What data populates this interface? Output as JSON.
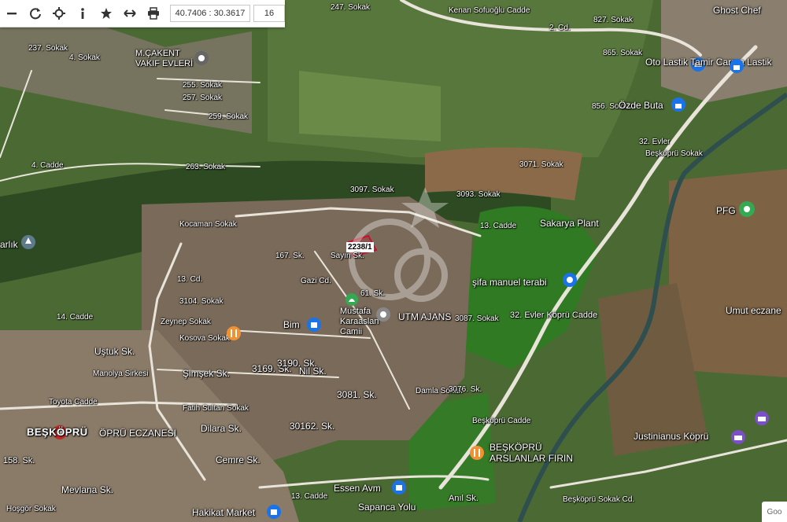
{
  "toolbar": {
    "buttons": [
      {
        "name": "zoom-out-button",
        "icon": "minus-icon"
      },
      {
        "name": "refresh-button",
        "icon": "refresh-icon"
      },
      {
        "name": "locate-button",
        "icon": "crosshair-icon"
      },
      {
        "name": "info-button",
        "icon": "info-icon"
      },
      {
        "name": "favorite-button",
        "icon": "star-icon"
      },
      {
        "name": "measure-button",
        "icon": "arrows-horizontal-icon"
      },
      {
        "name": "print-button",
        "icon": "printer-icon"
      }
    ],
    "coordinates": "40.7406 : 30.3617",
    "zoom_level": "16"
  },
  "parcel": {
    "label": "2238/1",
    "outline_color": "#c8102e"
  },
  "map": {
    "streets": [
      "247. Sokak",
      "Kenan Sofuoğlu Cadde",
      "2. Cd.",
      "827. Sokak",
      "237. Sokak",
      "4. Sokak",
      "255. Sokak",
      "257. Sokak",
      "259. Sokak",
      "4. Cadde",
      "263. Sokak",
      "865. Sokak",
      "856. Sokak",
      "32. Evler",
      "Beşköprü Sokak",
      "3071. Sokak",
      "3097. Sokak",
      "3093. Sokak",
      "13. Cadde",
      "167. Sk.",
      "Kocaman Sokak",
      "Sayın Sk.",
      "Gazi Cd.",
      "61. Sk.",
      "13. Cd.",
      "3104. Sokak",
      "14. Cadde",
      "Zeynep Sokak",
      "Kosova Sokak",
      "Uştuk Sk.",
      "Manolya Sirkesi",
      "Şimşek Sk.",
      "3169. Sk.",
      "3190. Sk.",
      "Nil Sk.",
      "Toyota Cadde",
      "Fatih Sultan Sokak",
      "Dilara Sk.",
      "30162. Sk.",
      "3081. Sk.",
      "Cemre Sk.",
      "158. Sk.",
      "Mevlana Sk.",
      "Hoşgör Sokak",
      "Sapanca Yolu",
      "Anıl Sk.",
      "Beşköprü Cadde",
      "3087. Sokak",
      "32. Evler Köprü Cadde",
      "Damla Sokak",
      "3076. Sk.",
      "13. Cadde",
      "Beşköprü Sokak Cd."
    ],
    "places": [
      {
        "name": "Ghost Chef",
        "icon": "restaurant-icon"
      },
      {
        "name": "Sakarya Plant",
        "icon": "plant-icon"
      },
      {
        "name": "şifa manuel terabi",
        "icon": "pin-icon"
      },
      {
        "name": "PFG",
        "icon": "flower-icon"
      },
      {
        "name": "Umut eczane",
        "icon": "pharmacy-icon"
      },
      {
        "name": "Mustafa Karaaslan Camii",
        "icon": "mosque-icon"
      },
      {
        "name": "UTM AJANS",
        "icon": "pin-icon"
      },
      {
        "name": "Bim",
        "icon": "shopping-icon"
      },
      {
        "name": "BEŞKÖPRÜ",
        "icon": "pin-icon"
      },
      {
        "name": "ÖPRÜ ECZANESI",
        "icon": "pharmacy-icon"
      },
      {
        "name": "BEŞKÖPRÜ ARSLANLAR FIRIN",
        "icon": "restaurant-icon"
      },
      {
        "name": "Justinianus Köprü",
        "icon": "landmark-icon"
      },
      {
        "name": "Essen Avm",
        "icon": "shopping-icon"
      },
      {
        "name": "Hakikat Market",
        "icon": "shopping-icon"
      },
      {
        "name": "Özde Buta",
        "icon": "lock-icon"
      },
      {
        "name": "Oto Lastik Tamir Carma Lastik",
        "icon": "car-icon"
      },
      {
        "name": "M.ÇAKENT VAKIF EVLERİ",
        "icon": "pin-icon"
      },
      {
        "name": "arlık",
        "icon": "park-icon"
      }
    ],
    "watermark": "google-logo"
  },
  "colors": {
    "accent_pin": "#1a73e8",
    "food_pin": "#f29132",
    "mosque_pin": "#34a853"
  }
}
